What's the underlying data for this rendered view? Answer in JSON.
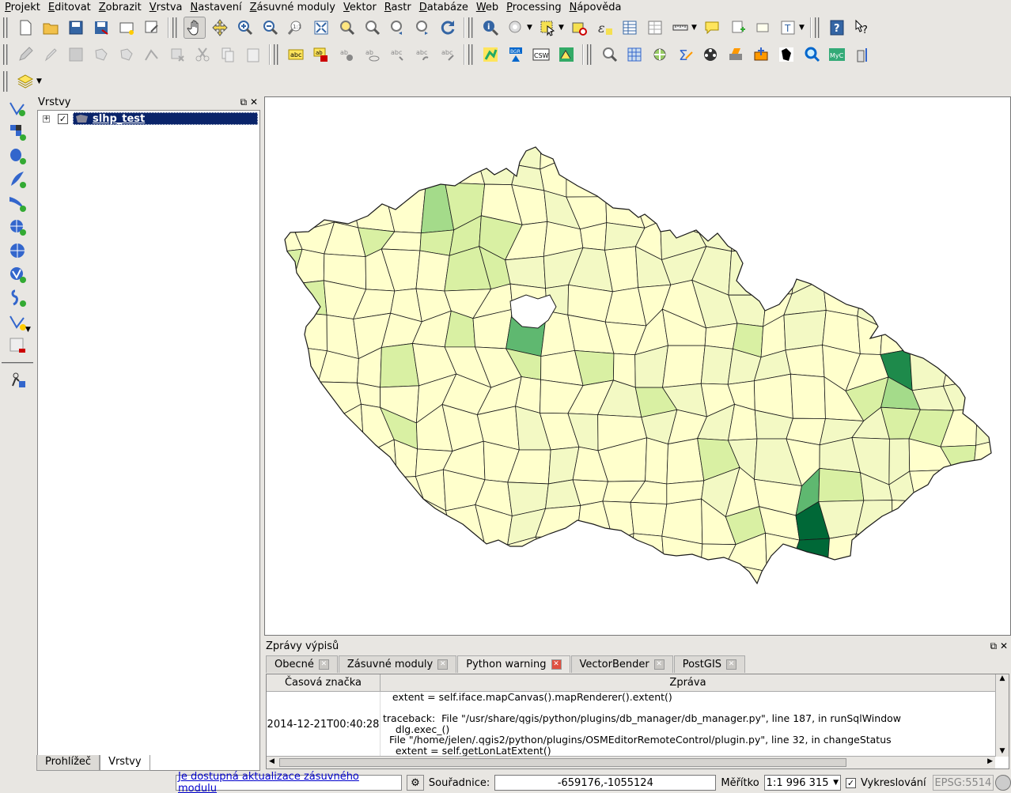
{
  "menu": [
    "Projekt",
    "Editovat",
    "Zobrazit",
    "Vrstva",
    "Nastavení",
    "Zásuvné moduly",
    "Vektor",
    "Rastr",
    "Databáze",
    "Web",
    "Processing",
    "Nápověda"
  ],
  "layers_panel": {
    "title": "Vrstvy",
    "layer_name": "slhp_test",
    "tabs": [
      "Prohlížeč",
      "Vrstvy"
    ]
  },
  "map": {
    "fill_colors": [
      "#ffffcc",
      "#f3f9c4",
      "#d9f0a3",
      "#a4db8a",
      "#5fb870",
      "#1e8a4b",
      "#006837"
    ],
    "outline": "#1a1a1a"
  },
  "log": {
    "title": "Zprávy výpisů",
    "tabs": [
      {
        "label": "Obecné"
      },
      {
        "label": "Zásuvné moduly"
      },
      {
        "label": "Python warning"
      },
      {
        "label": "VectorBender"
      },
      {
        "label": "PostGIS"
      }
    ],
    "columns": [
      "Časová značka",
      "Zpráva"
    ],
    "row": {
      "timestamp": "2014-12-21T00:40:28",
      "message": "   extent = self.iface.mapCanvas().mapRenderer().extent()\n\ntraceback:  File \"/usr/share/qgis/python/plugins/db_manager/db_manager.py\", line 187, in runSqlWindow\n    dlg.exec_()\n  File \"/home/jelen/.qgis2/python/plugins/OSMEditorRemoteControl/plugin.py\", line 32, in changeStatus\n    extent = self.getLonLatExtent()"
    }
  },
  "status": {
    "plugin_update": "Je dostupná aktualizace zásuvného modulu",
    "coord_label": "Souřadnice:",
    "coord_value": "-659176,-1055124",
    "scale_label": "Měřítko",
    "scale_value": "1:1 996 315",
    "render_label": "Vykreslování",
    "crs": "EPSG:5514"
  }
}
